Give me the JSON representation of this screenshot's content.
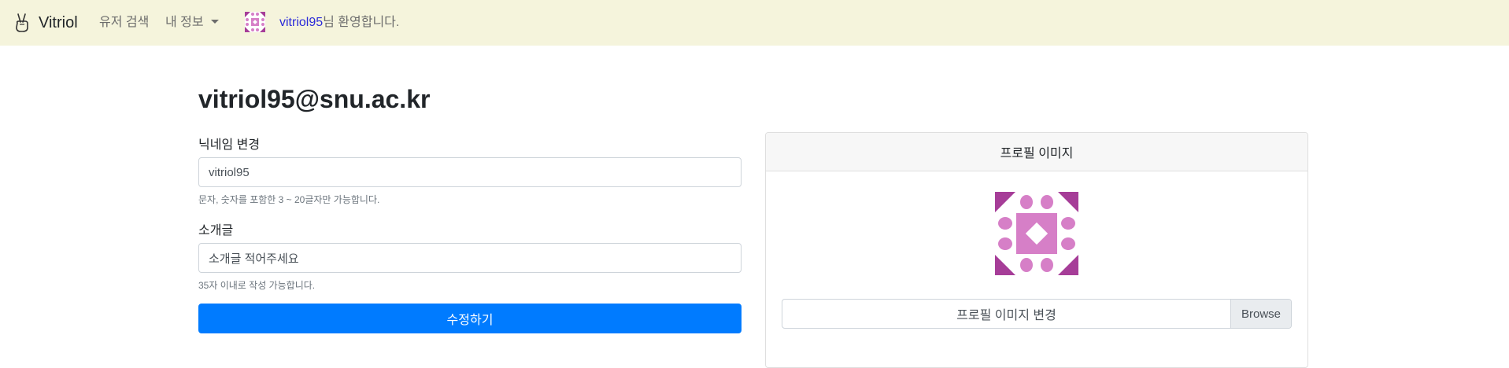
{
  "navbar": {
    "brand": "Vitriol",
    "user_search": "유저 검색",
    "my_info": "내 정보",
    "welcome_user": "vitriol95",
    "welcome_suffix": "님 환영합니다."
  },
  "profile": {
    "email": "vitriol95@snu.ac.kr",
    "nickname_label": "닉네임 변경",
    "nickname_value": "vitriol95",
    "nickname_help": "문자, 숫자를 포함한 3 ~ 20글자만 가능합니다.",
    "intro_label": "소개글",
    "intro_placeholder": "소개글 적어주세요",
    "intro_help": "35자 이내로 작성 가능합니다.",
    "submit_label": "수정하기"
  },
  "image_card": {
    "header": "프로필 이미지",
    "file_label": "프로필 이미지 변경",
    "browse_label": "Browse"
  },
  "colors": {
    "navbar_bg": "#f5f4dc",
    "primary": "#007bff",
    "avatar_dark": "#a63d98",
    "avatar_light": "#d67fc7"
  },
  "icons": {
    "brand": "peace-hand-icon",
    "caret": "caret-down-icon"
  }
}
